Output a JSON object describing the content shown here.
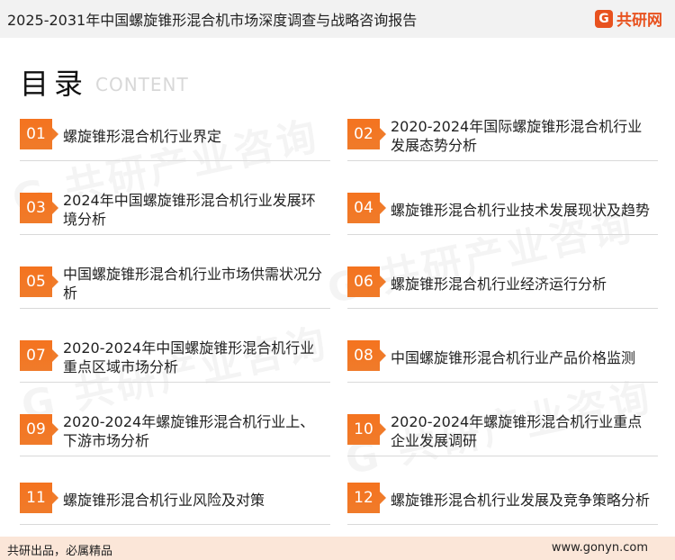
{
  "header": {
    "title": "2025-2031年中国螺旋锥形混合机市场深度调查与战略咨询报告"
  },
  "logo": {
    "text": "共研网",
    "icon": "logo-g-icon"
  },
  "watermark": {
    "text": "共研产业咨询",
    "site": "www.gonyn.com"
  },
  "section": {
    "title": "目录",
    "subtitle": "CONTENT"
  },
  "items": [
    {
      "num": "01",
      "label": "螺旋锥形混合机行业界定"
    },
    {
      "num": "02",
      "label": "2020-2024年国际螺旋锥形混合机行业发展态势分析"
    },
    {
      "num": "03",
      "label": "2024年中国螺旋锥形混合机行业发展环境分析"
    },
    {
      "num": "04",
      "label": "螺旋锥形混合机行业技术发展现状及趋势"
    },
    {
      "num": "05",
      "label": "中国螺旋锥形混合机行业市场供需状况分析"
    },
    {
      "num": "06",
      "label": "螺旋锥形混合机行业经济运行分析"
    },
    {
      "num": "07",
      "label": "2020-2024年中国螺旋锥形混合机行业重点区域市场分析"
    },
    {
      "num": "08",
      "label": "中国螺旋锥形混合机行业产品价格监测"
    },
    {
      "num": "09",
      "label": "2020-2024年螺旋锥形混合机行业上、下游市场分析"
    },
    {
      "num": "10",
      "label": "2020-2024年螺旋锥形混合机行业重点企业发展调研"
    },
    {
      "num": "11",
      "label": "螺旋锥形混合机行业风险及对策"
    },
    {
      "num": "12",
      "label": "螺旋锥形混合机行业发展及竞争策略分析"
    }
  ],
  "footer": {
    "left": "共研出品，必属精品",
    "right": "www.gonyn.com"
  },
  "colors": {
    "accent": "#f07b2a",
    "footer_bg": "#fbe6d8",
    "header_bg": "#f2f2f2"
  }
}
